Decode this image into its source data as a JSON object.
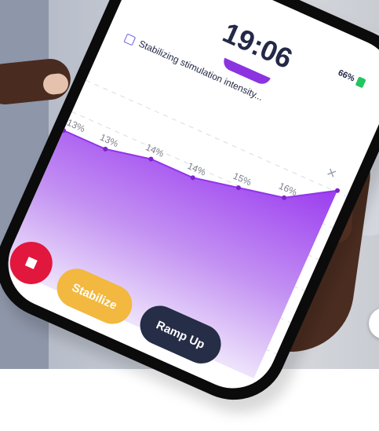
{
  "status_bar": {
    "time": "19:06",
    "battery": "66%"
  },
  "status_message": "Stabilizing stimulation intensity...",
  "chart_data": {
    "type": "area",
    "points": [
      {
        "label": "13%",
        "value": 13
      },
      {
        "label": "13%",
        "value": 13
      },
      {
        "label": "14%",
        "value": 14
      },
      {
        "label": "14%",
        "value": 14
      },
      {
        "label": "15%",
        "value": 15
      },
      {
        "label": "16%",
        "value": 16
      },
      {
        "label": "",
        "value": 19
      }
    ]
  },
  "buttons": {
    "stabilize": "Stabilize",
    "ramp_up": "Ramp Up"
  },
  "colors": {
    "accent": "#8b34e0",
    "stop": "#e1173d",
    "stabilize": "#f2b83f",
    "ramp_up": "#262d46"
  }
}
